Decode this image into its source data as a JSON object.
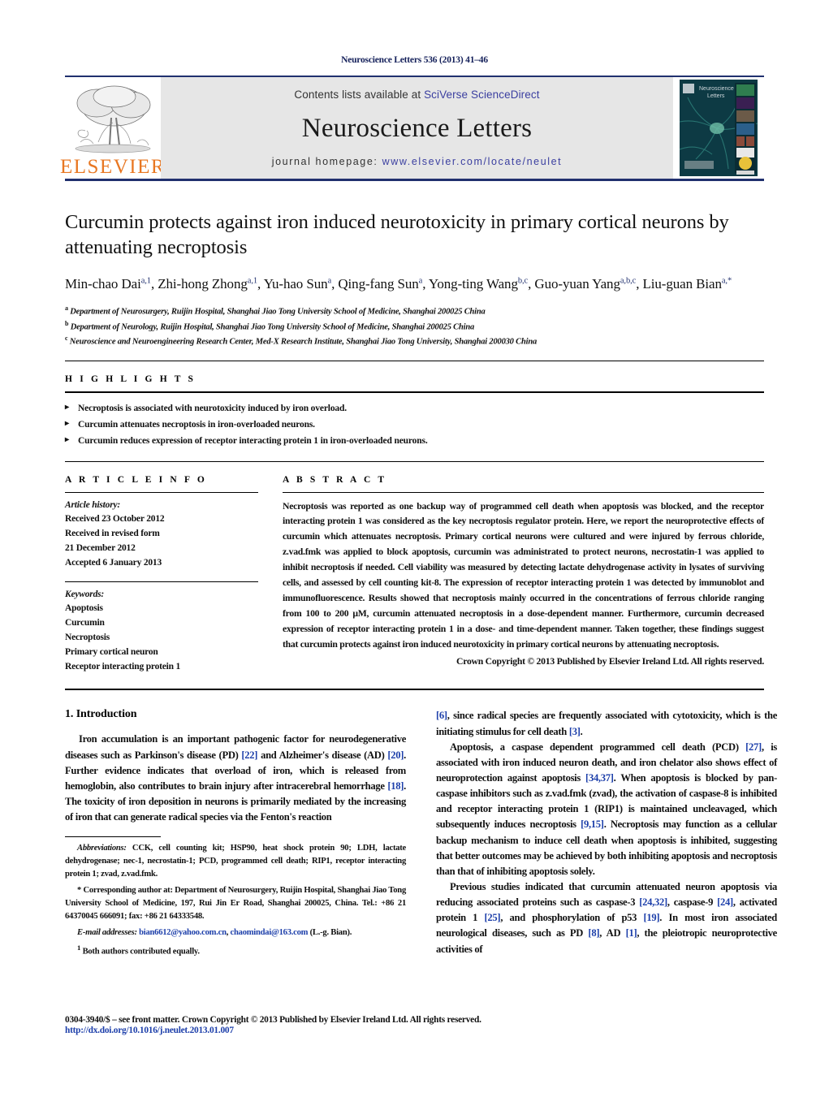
{
  "running_head": "Neuroscience Letters 536 (2013) 41–46",
  "journal_header": {
    "contents_prefix": "Contents lists available at ",
    "contents_link": "SciVerse ScienceDirect",
    "journal_title": "Neuroscience Letters",
    "homepage_prefix": "journal homepage: ",
    "homepage_url": "www.elsevier.com/locate/neulet",
    "publisher_logo_text": "ELSEVIER",
    "cover_title_line1": "Neuroscience",
    "cover_title_line2": "Letters",
    "accent_orange": "#e87722",
    "accent_blue": "#3b3fa0",
    "rule_blue": "#20306e"
  },
  "article": {
    "title": "Curcumin protects against iron induced neurotoxicity in primary cortical neurons by attenuating necroptosis",
    "authors_line1": "Min-chao Dai",
    "authors": [
      {
        "name": "Min-chao Dai",
        "sup": "a,1",
        "sep": ", "
      },
      {
        "name": "Zhi-hong Zhong",
        "sup": "a,1",
        "sep": ", "
      },
      {
        "name": "Yu-hao Sun",
        "sup": "a",
        "sep": ", "
      },
      {
        "name": "Qing-fang Sun",
        "sup": "a",
        "sep": ", "
      },
      {
        "name": "Yong-ting Wang",
        "sup": "b,c",
        "sep": ", "
      },
      {
        "name": "Guo-yuan Yang",
        "sup": "a,b,c",
        "sep": ", "
      },
      {
        "name": "Liu-guan Bian",
        "sup": "a,*",
        "sep": ""
      }
    ],
    "affiliations": [
      {
        "marker": "a",
        "text": "Department of Neurosurgery, Ruijin Hospital, Shanghai Jiao Tong University School of Medicine, Shanghai 200025 China"
      },
      {
        "marker": "b",
        "text": "Department of Neurology, Ruijin Hospital, Shanghai Jiao Tong University School of Medicine, Shanghai 200025 China"
      },
      {
        "marker": "c",
        "text": "Neuroscience and Neuroengineering Research Center, Med-X Research Institute, Shanghai Jiao Tong University, Shanghai 200030 China"
      }
    ]
  },
  "highlights": {
    "heading": "H I G H L I G H T S",
    "items": [
      "Necroptosis is associated with neurotoxicity induced by iron overload.",
      "Curcumin attenuates necroptosis in iron-overloaded neurons.",
      "Curcumin reduces expression of receptor interacting protein 1 in iron-overloaded neurons."
    ]
  },
  "article_info": {
    "heading": "A R T I C L E   I N F O",
    "history_label": "Article history:",
    "history": [
      "Received 23 October 2012",
      "Received in revised form",
      "21 December 2012",
      "Accepted 6 January 2013"
    ],
    "keywords_label": "Keywords:",
    "keywords": [
      "Apoptosis",
      "Curcumin",
      "Necroptosis",
      "Primary cortical neuron",
      "Receptor interacting protein 1"
    ]
  },
  "abstract": {
    "heading": "A B S T R A C T",
    "text": "Necroptosis was reported as one backup way of programmed cell death when apoptosis was blocked, and the receptor interacting protein 1 was considered as the key necroptosis regulator protein. Here, we report the neuroprotective effects of curcumin which attenuates necroptosis. Primary cortical neurons were cultured and were injured by ferrous chloride, z.vad.fmk was applied to block apoptosis, curcumin was administrated to protect neurons, necrostatin-1 was applied to inhibit necroptosis if needed. Cell viability was measured by detecting lactate dehydrogenase activity in lysates of surviving cells, and assessed by cell counting kit-8. The expression of receptor interacting protein 1 was detected by immunoblot and immunofluorescence. Results showed that necroptosis mainly occurred in the concentrations of ferrous chloride ranging from 100 to 200 μM, curcumin attenuated necroptosis in a dose-dependent manner. Furthermore, curcumin decreased expression of receptor interacting protein 1 in a dose- and time-dependent manner. Taken together, these findings suggest that curcumin protects against iron induced neurotoxicity in primary cortical neurons by attenuating necroptosis.",
    "copyright": "Crown Copyright © 2013 Published by Elsevier Ireland Ltd. All rights reserved."
  },
  "introduction": {
    "section_title": "1.  Introduction",
    "left_para_1_a": "Iron accumulation is an important pathogenic factor for neurodegenerative diseases such as Parkinson's disease (PD) ",
    "left_ref_22": "[22]",
    "left_para_1_b": " and Alzheimer's disease (AD) ",
    "left_ref_20": "[20]",
    "left_para_1_c": ". Further evidence indicates that overload of iron, which is released from hemoglobin, also contributes to brain injury after intracerebral hemorrhage ",
    "left_ref_18": "[18]",
    "left_para_1_d": ". The toxicity of iron deposition in neurons is primarily mediated by the increasing of iron that can generate radical species via the Fenton's reaction"
  },
  "right_column": {
    "ref_6": "[6]",
    "cont_a": ", since radical species are frequently associated with cytotoxicity, which is the initiating stimulus for cell death ",
    "ref_3": "[3]",
    "cont_b": ".",
    "p2_a": "Apoptosis, a caspase dependent programmed cell death (PCD) ",
    "ref_27": "[27]",
    "p2_b": ", is associated with iron induced neuron death, and iron chelator also shows effect of neuroprotection against apoptosis ",
    "ref_3437": "[34,37]",
    "p2_c": ". When apoptosis is blocked by pan-caspase inhibitors such as z.vad.fmk (zvad), the activation of caspase-8 is inhibited and receptor interacting protein 1 (RIP1) is maintained uncleavaged, which subsequently induces necroptosis ",
    "ref_915": "[9,15]",
    "p2_d": ". Necroptosis may function as a cellular backup mechanism to induce cell death when apoptosis is inhibited, suggesting that better outcomes may be achieved by both inhibiting apoptosis and necroptosis than that of inhibiting apoptosis solely.",
    "p3_a": "Previous studies indicated that curcumin attenuated neuron apoptosis via reducing associated proteins such as caspase-3 ",
    "ref_2432": "[24,32]",
    "p3_b": ", caspase-9 ",
    "ref_24": "[24]",
    "p3_c": ", activated protein 1 ",
    "ref_25": "[25]",
    "p3_d": ", and phosphorylation of p53 ",
    "ref_19": "[19]",
    "p3_e": ". In most iron associated neurological diseases, such as PD ",
    "ref_8": "[8]",
    "p3_f": ", AD ",
    "ref_1": "[1]",
    "p3_g": ", the pleiotropic neuroprotective activities of"
  },
  "footnotes": {
    "abbrev_label": "Abbreviations:",
    "abbrev_text": " CCK, cell counting kit; HSP90, heat shock protein 90; LDH, lactate dehydrogenase; nec-1, necrostatin-1; PCD, programmed cell death; RIP1, receptor interacting protein 1; zvad, z.vad.fmk.",
    "corresponding": "* Corresponding author at: Department of Neurosurgery, Ruijin Hospital, Shanghai Jiao Tong University School of Medicine, 197, Rui Jin Er Road, Shanghai 200025, China. Tel.: +86 21 64370045 666091; fax: +86 21 64333548.",
    "email_label": "E-mail addresses:",
    "email_1": "bian6612@yahoo.com.cn",
    "email_2": "chaomindai@163.com",
    "email_suffix": " (L.-g. Bian).",
    "equal_marker": "1",
    "equal_text": " Both authors contributed equally."
  },
  "page_footer": {
    "line1": "0304-3940/$ – see front matter. Crown Copyright © 2013 Published by Elsevier Ireland Ltd. All rights reserved.",
    "line2": "http://dx.doi.org/10.1016/j.neulet.2013.01.007"
  }
}
